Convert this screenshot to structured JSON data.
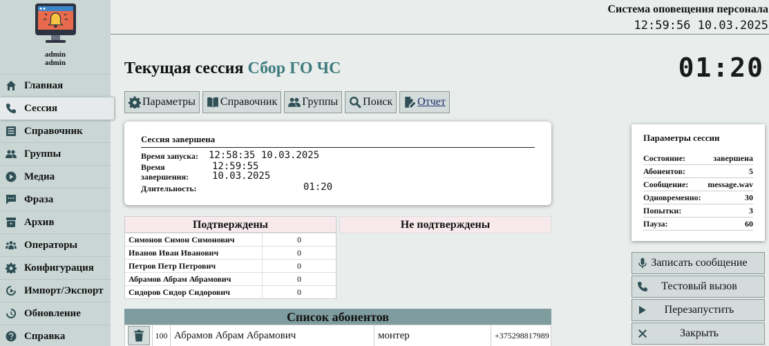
{
  "user": {
    "name": "admin",
    "role": "admin"
  },
  "nav": [
    {
      "label": "Главная",
      "icon": "home-icon"
    },
    {
      "label": "Сессия",
      "icon": "phone-icon",
      "active": true
    },
    {
      "label": "Справочник",
      "icon": "book-icon"
    },
    {
      "label": "Группы",
      "icon": "group-icon"
    },
    {
      "label": "Медиа",
      "icon": "play-circle-icon"
    },
    {
      "label": "Фраза",
      "icon": "comment-icon"
    },
    {
      "label": "Архив",
      "icon": "archive-icon"
    },
    {
      "label": "Операторы",
      "icon": "users-icon"
    },
    {
      "label": "Конфигурация",
      "icon": "gear-icon"
    },
    {
      "label": "Импорт/Экспорт",
      "icon": "import-export-icon"
    },
    {
      "label": "Обновление",
      "icon": "refresh-icon"
    },
    {
      "label": "Справка",
      "icon": "help-icon"
    }
  ],
  "header": {
    "title": "Система оповещения персонала",
    "clock": "12:59:56 10.03.2025"
  },
  "page": {
    "title": "Текущая сессия",
    "session_name": "Сбор ГО ЧС",
    "timer": "01:20"
  },
  "toolbar": {
    "params": "Параметры",
    "directory": "Справочник",
    "groups": "Группы",
    "search": "Поиск",
    "report": "Отчет"
  },
  "session": {
    "status_heading": "Сессия завершена",
    "start_label": "Время запуска:",
    "start_value": "12:58:35 10.03.2025",
    "end_label_1": "Время",
    "end_label_2": "завершения:",
    "end_time": "12:59:55",
    "end_date": "10.03.2025",
    "duration_label": "Длительность:",
    "duration_value": "01:20"
  },
  "confirmed": {
    "title": "Подтверждены",
    "rows": [
      {
        "name": "Симонов Симон Симонович",
        "count": "0"
      },
      {
        "name": "Иванов Иван Иванович",
        "count": "0"
      },
      {
        "name": "Петров Петр Петрович",
        "count": "0"
      },
      {
        "name": "Абрамов Абрам Абрамович",
        "count": "0"
      },
      {
        "name": "Сидоров Сидор Сидорович",
        "count": "0"
      }
    ]
  },
  "unconfirmed": {
    "title": "Не подтверждены"
  },
  "subscribers": {
    "title": "Список абонентов",
    "rows": [
      {
        "num": "100",
        "name": "Абрамов Абрам Абрамович",
        "position": "монтер",
        "phone": "+375298817989"
      }
    ]
  },
  "params": {
    "title": "Параметры сессии",
    "rows": [
      {
        "label": "Состояние:",
        "value": "завершена"
      },
      {
        "label": "Абонентов:",
        "value": "5"
      },
      {
        "label": "Сообщение:",
        "value": "message.wav"
      },
      {
        "label": "Одновременно:",
        "value": "30"
      },
      {
        "label": "Попытки:",
        "value": "3"
      },
      {
        "label": "Пауза:",
        "value": "60"
      }
    ]
  },
  "actions": {
    "record": "Записать сообщение",
    "test_call": "Тестовый вызов",
    "restart": "Перезапустить",
    "close": "Закрыть"
  },
  "colors": {
    "sidebar": "#c9d6d4",
    "accent": "#3e7c80",
    "button": "#d3dcdb",
    "list_header": "#7f9c9e"
  }
}
